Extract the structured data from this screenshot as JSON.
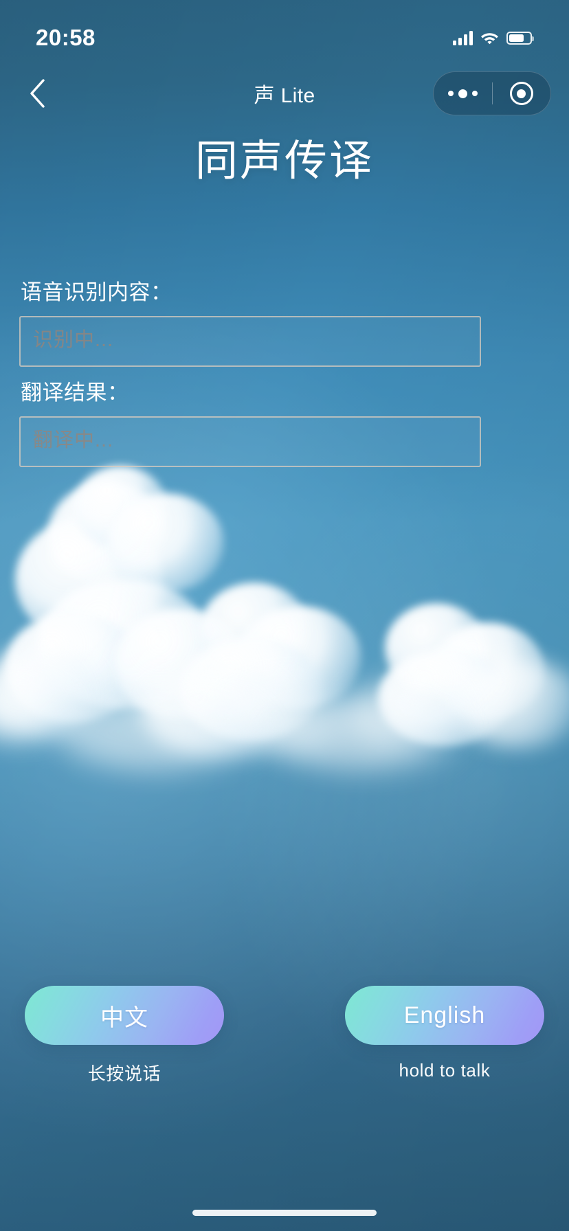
{
  "status_bar": {
    "time": "20:58",
    "signal_icon": "cellular-signal-icon",
    "signal_bars": 4,
    "wifi_icon": "wifi-icon",
    "battery_icon": "battery-icon",
    "battery_level_percent": 74
  },
  "nav_bar": {
    "back_icon": "back-chevron-icon",
    "title": "声 Lite",
    "capsule": {
      "menu_icon": "more-options-icon",
      "close_icon": "target-circle-icon"
    }
  },
  "main": {
    "page_title": "同声传译",
    "fields": [
      {
        "label": "语音识别内容：",
        "placeholder": "识别中...",
        "value": ""
      },
      {
        "label": "翻译结果：",
        "placeholder": "翻译中...",
        "value": ""
      }
    ]
  },
  "bottom_controls": [
    {
      "button_label": "中文",
      "hint": "长按说话"
    },
    {
      "button_label": "English",
      "hint": "hold to talk"
    }
  ],
  "colors": {
    "sky_top": "#2c6585",
    "sky_mid": "#4a9ac4",
    "sky_bottom": "#2c6080",
    "button_gradient_start": "#7ee8d2",
    "button_gradient_end": "#a396f7",
    "field_border": "#decdbe",
    "placeholder_text": "#96847a",
    "text_primary": "#ffffff"
  },
  "home_indicator": "home-indicator-bar"
}
